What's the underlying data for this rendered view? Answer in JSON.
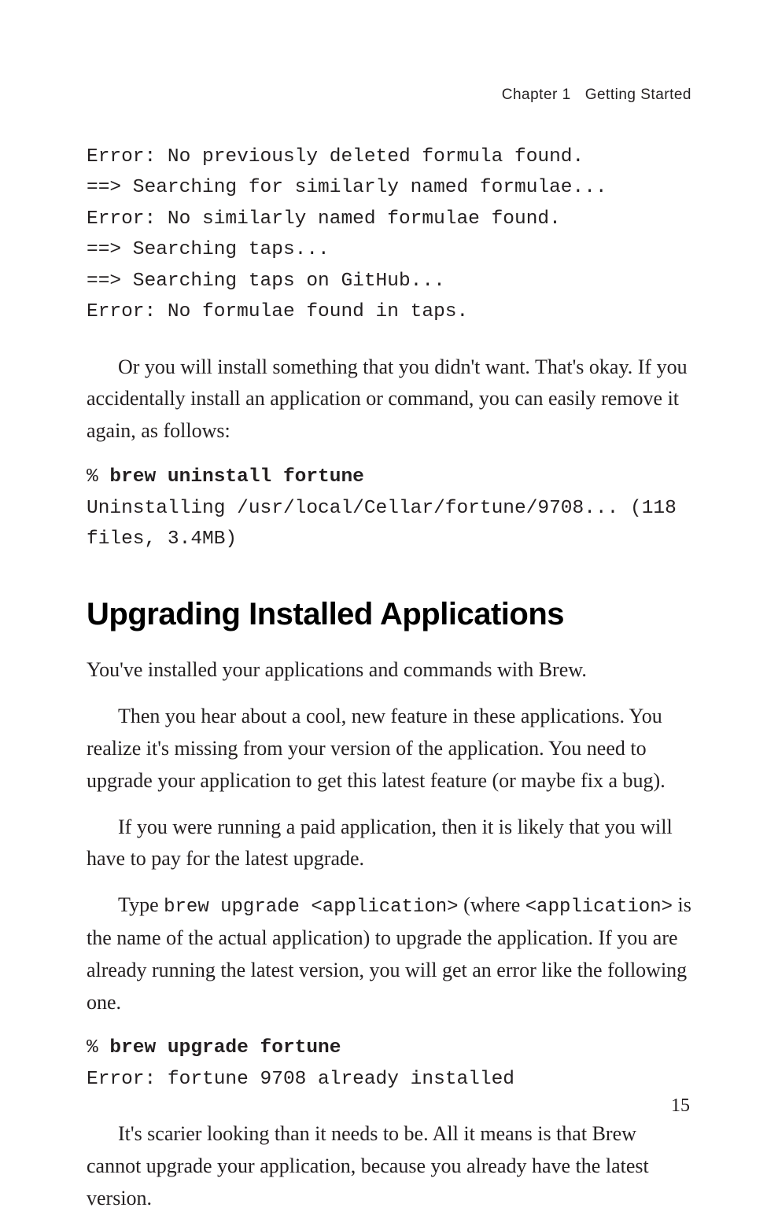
{
  "header": {
    "chapter": "Chapter 1",
    "title": "Getting Started"
  },
  "code_block_1": {
    "line1": "Error: No previously deleted formula found.",
    "line2": "==> Searching for similarly named formulae...",
    "line3": "Error: No similarly named formulae found.",
    "line4": "==> Searching taps...",
    "line5": "==> Searching taps on GitHub...",
    "line6": "Error: No formulae found in taps."
  },
  "para1": "Or you will install something that you didn't want. That's okay. If you accidentally install an application or command, you can easily remove it again, as follows:",
  "code_block_2": {
    "prompt": "% ",
    "cmd": "brew uninstall fortune",
    "out": "Uninstalling /usr/local/Cellar/fortune/9708... (118 files, 3.4MB)"
  },
  "heading": "Upgrading Installed Applications",
  "para2": "You've installed your applications and commands with Brew.",
  "para3": "Then you hear about a cool, new feature in these applications. You realize it's missing from your version of the application. You need to upgrade your application to get this latest feature (or maybe fix a bug).",
  "para4": "If you were running a paid application, then it is likely that you will have to pay for the latest upgrade.",
  "para5": {
    "t1": "Type ",
    "c1": "brew upgrade <application>",
    "t2": " (where ",
    "c2": "<application>",
    "t3": " is the name of the actual application) to upgrade the application. If you are already running the latest version, you will get an error like the following one."
  },
  "code_block_3": {
    "prompt": "% ",
    "cmd": "brew upgrade fortune",
    "out": "Error: fortune 9708 already installed"
  },
  "para6": "It's scarier looking than it needs to be. All it means is that Brew cannot upgrade your application, because you already have the latest version.",
  "page_number": "15"
}
